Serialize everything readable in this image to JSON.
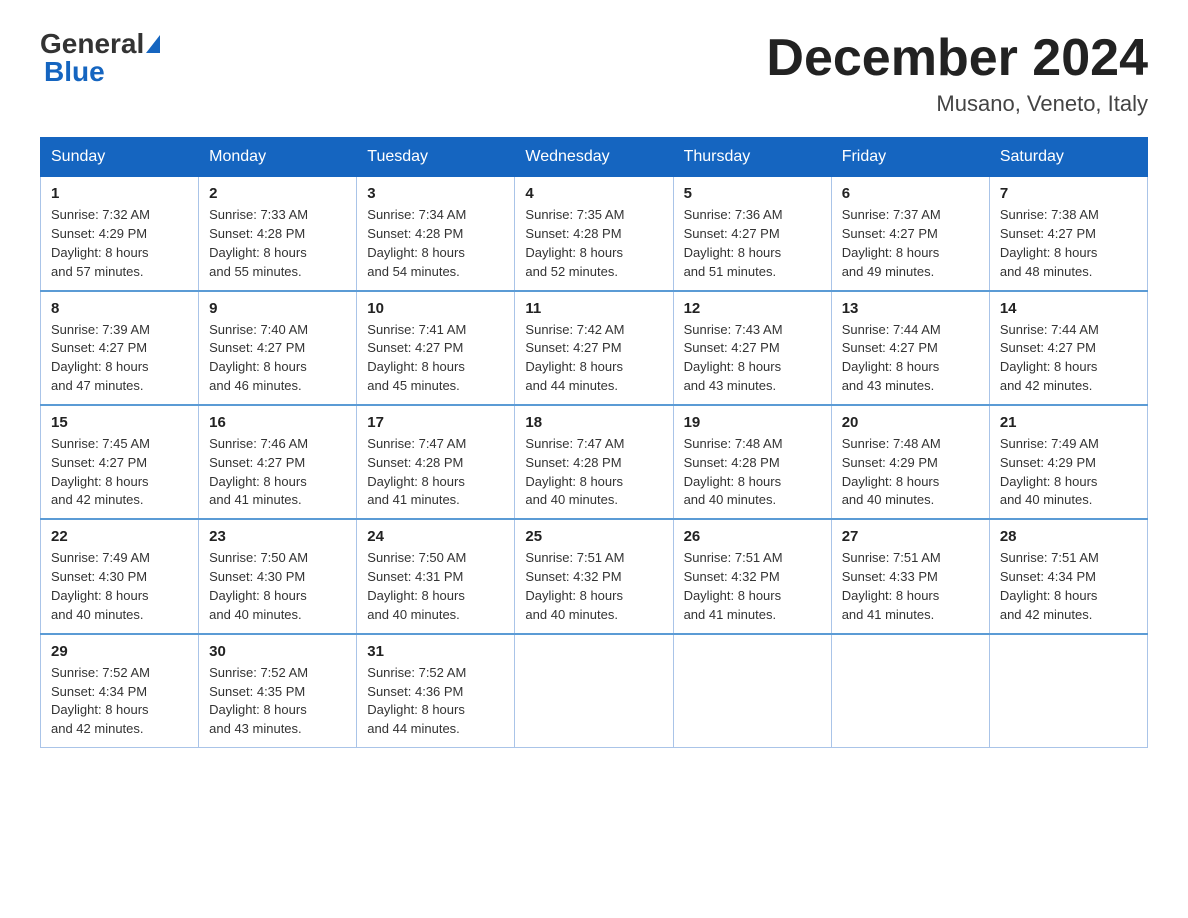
{
  "logo": {
    "general": "General",
    "blue": "Blue"
  },
  "title": "December 2024",
  "location": "Musano, Veneto, Italy",
  "weekdays": [
    "Sunday",
    "Monday",
    "Tuesday",
    "Wednesday",
    "Thursday",
    "Friday",
    "Saturday"
  ],
  "weeks": [
    [
      {
        "day": "1",
        "sunrise": "7:32 AM",
        "sunset": "4:29 PM",
        "daylight": "8 hours and 57 minutes."
      },
      {
        "day": "2",
        "sunrise": "7:33 AM",
        "sunset": "4:28 PM",
        "daylight": "8 hours and 55 minutes."
      },
      {
        "day": "3",
        "sunrise": "7:34 AM",
        "sunset": "4:28 PM",
        "daylight": "8 hours and 54 minutes."
      },
      {
        "day": "4",
        "sunrise": "7:35 AM",
        "sunset": "4:28 PM",
        "daylight": "8 hours and 52 minutes."
      },
      {
        "day": "5",
        "sunrise": "7:36 AM",
        "sunset": "4:27 PM",
        "daylight": "8 hours and 51 minutes."
      },
      {
        "day": "6",
        "sunrise": "7:37 AM",
        "sunset": "4:27 PM",
        "daylight": "8 hours and 49 minutes."
      },
      {
        "day": "7",
        "sunrise": "7:38 AM",
        "sunset": "4:27 PM",
        "daylight": "8 hours and 48 minutes."
      }
    ],
    [
      {
        "day": "8",
        "sunrise": "7:39 AM",
        "sunset": "4:27 PM",
        "daylight": "8 hours and 47 minutes."
      },
      {
        "day": "9",
        "sunrise": "7:40 AM",
        "sunset": "4:27 PM",
        "daylight": "8 hours and 46 minutes."
      },
      {
        "day": "10",
        "sunrise": "7:41 AM",
        "sunset": "4:27 PM",
        "daylight": "8 hours and 45 minutes."
      },
      {
        "day": "11",
        "sunrise": "7:42 AM",
        "sunset": "4:27 PM",
        "daylight": "8 hours and 44 minutes."
      },
      {
        "day": "12",
        "sunrise": "7:43 AM",
        "sunset": "4:27 PM",
        "daylight": "8 hours and 43 minutes."
      },
      {
        "day": "13",
        "sunrise": "7:44 AM",
        "sunset": "4:27 PM",
        "daylight": "8 hours and 43 minutes."
      },
      {
        "day": "14",
        "sunrise": "7:44 AM",
        "sunset": "4:27 PM",
        "daylight": "8 hours and 42 minutes."
      }
    ],
    [
      {
        "day": "15",
        "sunrise": "7:45 AM",
        "sunset": "4:27 PM",
        "daylight": "8 hours and 42 minutes."
      },
      {
        "day": "16",
        "sunrise": "7:46 AM",
        "sunset": "4:27 PM",
        "daylight": "8 hours and 41 minutes."
      },
      {
        "day": "17",
        "sunrise": "7:47 AM",
        "sunset": "4:28 PM",
        "daylight": "8 hours and 41 minutes."
      },
      {
        "day": "18",
        "sunrise": "7:47 AM",
        "sunset": "4:28 PM",
        "daylight": "8 hours and 40 minutes."
      },
      {
        "day": "19",
        "sunrise": "7:48 AM",
        "sunset": "4:28 PM",
        "daylight": "8 hours and 40 minutes."
      },
      {
        "day": "20",
        "sunrise": "7:48 AM",
        "sunset": "4:29 PM",
        "daylight": "8 hours and 40 minutes."
      },
      {
        "day": "21",
        "sunrise": "7:49 AM",
        "sunset": "4:29 PM",
        "daylight": "8 hours and 40 minutes."
      }
    ],
    [
      {
        "day": "22",
        "sunrise": "7:49 AM",
        "sunset": "4:30 PM",
        "daylight": "8 hours and 40 minutes."
      },
      {
        "day": "23",
        "sunrise": "7:50 AM",
        "sunset": "4:30 PM",
        "daylight": "8 hours and 40 minutes."
      },
      {
        "day": "24",
        "sunrise": "7:50 AM",
        "sunset": "4:31 PM",
        "daylight": "8 hours and 40 minutes."
      },
      {
        "day": "25",
        "sunrise": "7:51 AM",
        "sunset": "4:32 PM",
        "daylight": "8 hours and 40 minutes."
      },
      {
        "day": "26",
        "sunrise": "7:51 AM",
        "sunset": "4:32 PM",
        "daylight": "8 hours and 41 minutes."
      },
      {
        "day": "27",
        "sunrise": "7:51 AM",
        "sunset": "4:33 PM",
        "daylight": "8 hours and 41 minutes."
      },
      {
        "day": "28",
        "sunrise": "7:51 AM",
        "sunset": "4:34 PM",
        "daylight": "8 hours and 42 minutes."
      }
    ],
    [
      {
        "day": "29",
        "sunrise": "7:52 AM",
        "sunset": "4:34 PM",
        "daylight": "8 hours and 42 minutes."
      },
      {
        "day": "30",
        "sunrise": "7:52 AM",
        "sunset": "4:35 PM",
        "daylight": "8 hours and 43 minutes."
      },
      {
        "day": "31",
        "sunrise": "7:52 AM",
        "sunset": "4:36 PM",
        "daylight": "8 hours and 44 minutes."
      },
      null,
      null,
      null,
      null
    ]
  ]
}
